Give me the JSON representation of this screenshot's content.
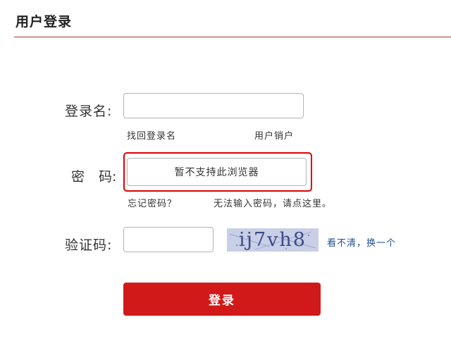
{
  "header": {
    "title": "用户登录"
  },
  "form": {
    "username": {
      "label": "登录名:",
      "value": "",
      "links": {
        "recover": "找回登录名",
        "deactivate": "用户销户"
      }
    },
    "password": {
      "label_first": "密",
      "label_second": "码:",
      "field_text": "暂不支持此浏览器",
      "links": {
        "forgot": "忘记密码？",
        "cannot_input": "无法输入密码，请点这里。"
      }
    },
    "captcha": {
      "label": "验证码:",
      "value": "",
      "image_text": "ij7vh8",
      "refresh_link": "看不清，换一个"
    },
    "submit_label": "登录"
  },
  "colors": {
    "accent": "#d11919",
    "highlight": "#e00000",
    "link": "#1f4f96",
    "captcha_bg": "#c9cfe6"
  }
}
